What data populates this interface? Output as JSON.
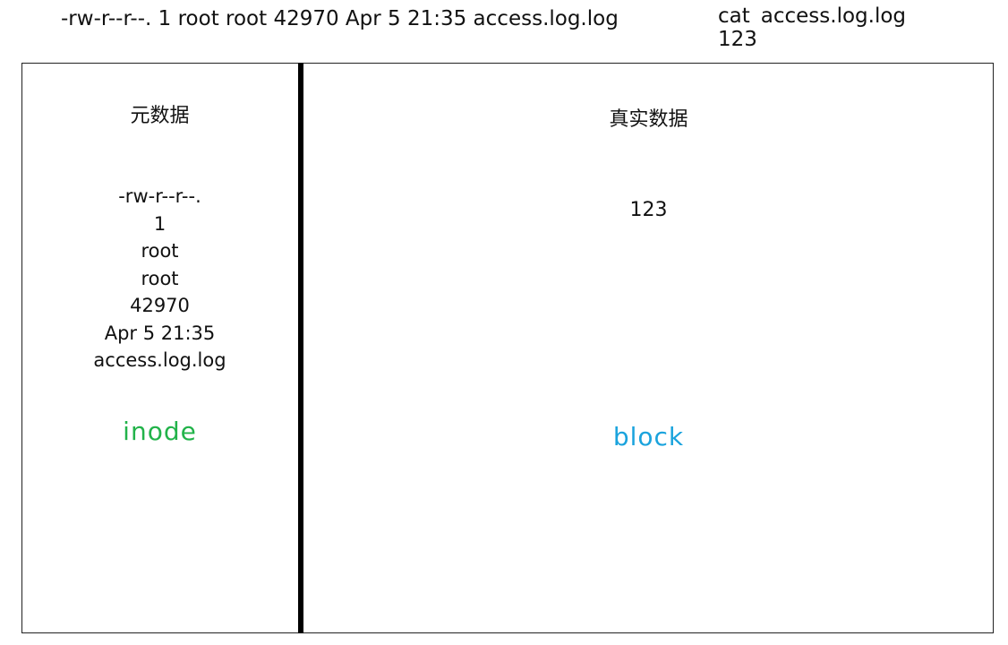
{
  "header": {
    "ls_line": "-rw-r--r--. 1 root root 42970 Apr 5 21:35 access.log.log",
    "cat_command": "cat",
    "cat_argument": "access.log.log",
    "cat_output": "123"
  },
  "metadata_panel": {
    "title": "元数据",
    "fields": [
      "-rw-r--r--.",
      "1",
      "root",
      "root",
      "42970",
      "Apr 5 21:35",
      "access.log.log"
    ],
    "label": "inode"
  },
  "data_panel": {
    "title": "真实数据",
    "value": "123",
    "label": "block"
  },
  "colors": {
    "inode": "#22b34a",
    "block": "#1aa3dd",
    "divider": "#000000"
  }
}
